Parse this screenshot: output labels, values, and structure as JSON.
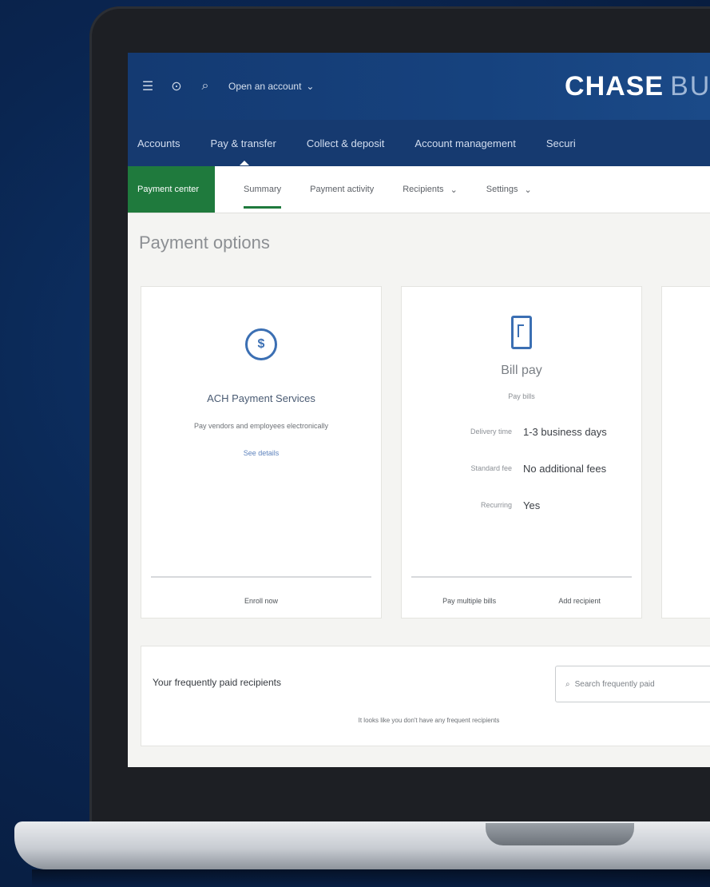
{
  "header": {
    "open_account": "Open an account",
    "brand_chase": "CHASE",
    "brand_business": "BUS"
  },
  "main_nav": [
    {
      "label": "Accounts"
    },
    {
      "label": "Pay & transfer"
    },
    {
      "label": "Collect & deposit"
    },
    {
      "label": "Account management"
    },
    {
      "label": "Securi"
    }
  ],
  "sub_nav": {
    "payment_center": "Payment center",
    "tabs": [
      {
        "label": "Summary"
      },
      {
        "label": "Payment activity"
      },
      {
        "label": "Recipients"
      },
      {
        "label": "Settings"
      }
    ]
  },
  "payment_options": {
    "title": "Payment options",
    "ach": {
      "title": "ACH Payment Services",
      "description": "Pay vendors and employees electronically",
      "link": "See details",
      "footer": "Enroll now"
    },
    "bill_pay": {
      "title": "Bill pay",
      "subtitle": "Pay bills",
      "details": [
        {
          "key": "Delivery time",
          "value": "1-3 business days"
        },
        {
          "key": "Standard fee",
          "value": "No additional fees"
        },
        {
          "key": "Recurring",
          "value": "Yes"
        }
      ],
      "footer_left": "Pay multiple bills",
      "footer_right": "Add recipient"
    }
  },
  "recipients": {
    "title": "Your frequently paid recipients",
    "search_placeholder": "Search frequently paid",
    "empty_message": "It looks like you don't have any frequent recipients"
  },
  "colors": {
    "nav_blue": "#163a70",
    "payment_center_green": "#1f7a3d",
    "icon_blue": "#3b6fb3"
  }
}
